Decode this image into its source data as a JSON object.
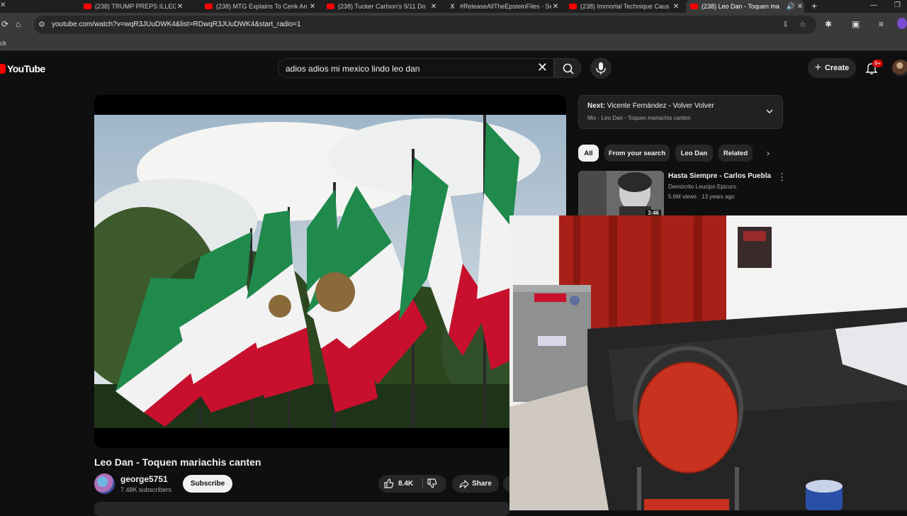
{
  "browser": {
    "tabs": [
      {
        "title": "(238) TRUMP PREPS ILLEGAL G",
        "icon": "youtube-icon"
      },
      {
        "title": "(238) MTG Explains To Cenk An",
        "icon": "youtube-icon"
      },
      {
        "title": "(238) Tucker Carlson's 9/11 Do",
        "icon": "youtube-icon"
      },
      {
        "title": "#ReleaseAllTheEpsteinFiles - Se",
        "icon": "x-icon"
      },
      {
        "title": "(238) Immortal Technique Caus",
        "icon": "youtube-icon"
      },
      {
        "title": "(238) Leo Dan - Toquen ma",
        "icon": "youtube-icon",
        "active": true
      }
    ],
    "url": "youtube.com/watch?v=wqR3JUuDWK4&list=RDwqR3JUuDWK4&start_radio=1",
    "bookmark_fragment": "ck"
  },
  "header": {
    "logo_text": "YouTube",
    "search_query": "adios adios mi mexico lindo leo dan",
    "create_label": "Create",
    "notification_badge": "9+"
  },
  "video": {
    "title": "Leo Dan - Toquen mariachis canten",
    "channel": "george5751",
    "subscribers": "7.48K subscribers",
    "subscribe_label": "Subscribe",
    "likes": "8.4K",
    "share_label": "Share"
  },
  "queue": {
    "next_prefix": "Next:",
    "next_title": "Vicente Fernández - Volver Volver",
    "mix_label": "Mix - Leo Dan - Toquen mariachis canten"
  },
  "chips": [
    "All",
    "From your search",
    "Leo Dan",
    "Related"
  ],
  "recommendations": [
    {
      "title": "Hasta Siempre - Carlos Puebla",
      "channel": "Demócrito Leucipo Epicuro",
      "meta": "5.6M views · 13 years ago",
      "duration": "3:46"
    }
  ],
  "colors": {
    "brand_red": "#ff0000",
    "background": "#0f0f0f",
    "flag_green": "#1f8a4c",
    "flag_red": "#c8102e"
  }
}
